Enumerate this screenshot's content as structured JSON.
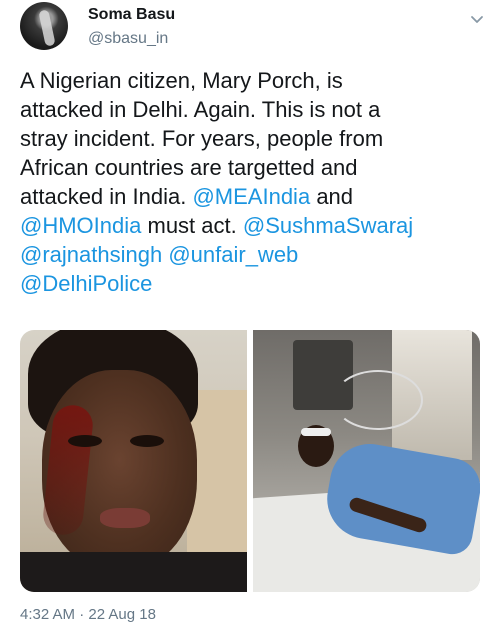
{
  "author": {
    "display_name": "Soma Basu",
    "handle": "@sbasu_in"
  },
  "tweet": {
    "text_segments": [
      {
        "text": "A Nigerian citizen, Mary Porch, is",
        "type": "text"
      },
      {
        "text": "attacked in Delhi. Again. This is not a",
        "type": "text"
      },
      {
        "text": "stray incident. For years, people from",
        "type": "text"
      },
      {
        "text": "African countries are targetted and",
        "type": "text"
      },
      {
        "text": "attacked in India.",
        "type": "text"
      },
      {
        "text": "@MEAIndia",
        "type": "mention"
      },
      {
        "text": "and",
        "type": "text"
      },
      {
        "text": "@HMOIndia",
        "type": "mention"
      },
      {
        "text": "must act.",
        "type": "text"
      },
      {
        "text": "@SushmaSwaraj",
        "type": "mention"
      },
      {
        "text": "@rajnathsingh",
        "type": "mention"
      },
      {
        "text": "@unfair_web",
        "type": "mention"
      },
      {
        "text": "@DelhiPolice",
        "type": "mention"
      }
    ]
  },
  "timestamp": "4:32 AM · 22 Aug 18",
  "icons": {
    "menu": "chevron-down-icon"
  },
  "colors": {
    "mention": "#1b95e0",
    "secondary_text": "#657786",
    "primary_text": "#14171a"
  }
}
